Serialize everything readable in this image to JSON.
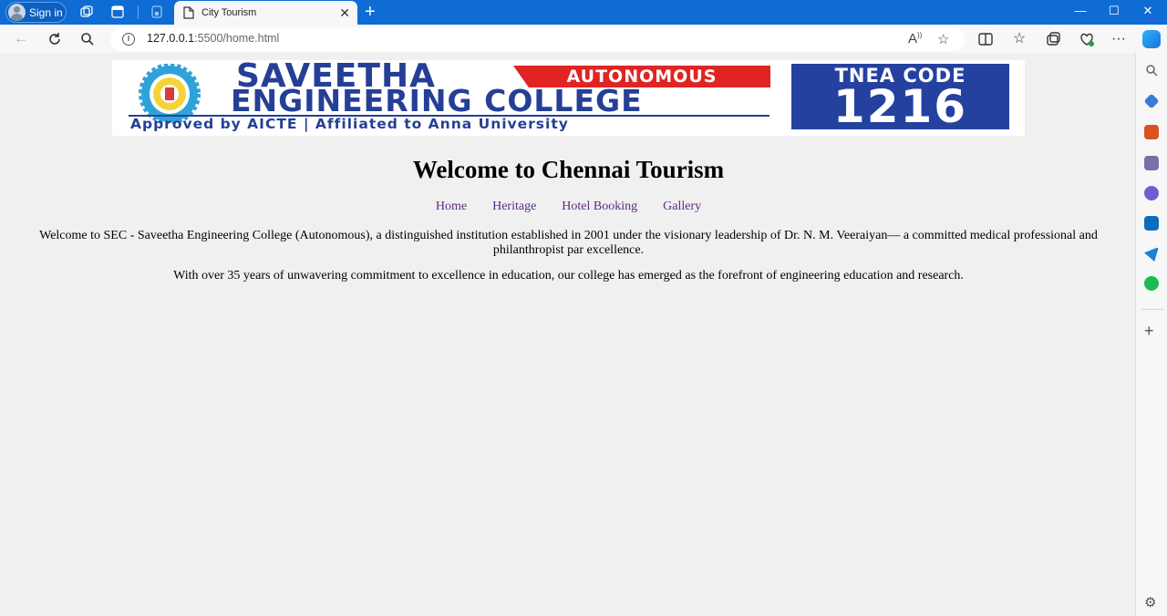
{
  "browser": {
    "signin_label": "Sign in",
    "tab_title": "City Tourism",
    "tab_close": "✕",
    "new_tab": "+",
    "window": {
      "minimize": "—",
      "maximize": "☐",
      "close": "✕"
    },
    "url_host": "127.0.0.1",
    "url_rest": ":5500/home.html"
  },
  "banner": {
    "line1": "SAVEETHA",
    "line2": "ENGINEERING COLLEGE",
    "badge": "AUTONOMOUS",
    "tagline": "Approved by AICTE  |  Affiliated to Anna University",
    "code_label": "TNEA CODE",
    "code": "1216",
    "colors": {
      "blue": "#253f96",
      "red": "#e02424"
    }
  },
  "page": {
    "heading": "Welcome to Chennai Tourism",
    "nav": [
      "Home",
      "Heritage",
      "Hotel Booking",
      "Gallery"
    ],
    "para1": "Welcome to SEC - Saveetha Engineering College (Autonomous), a distinguished institution established in 2001 under the visionary leadership of Dr. N. M. Veeraiyan— a committed medical professional and philanthropist par excellence.",
    "para2": "With over 35 years of unwavering commitment to excellence in education, our college has emerged as the forefront of engineering education and research."
  }
}
